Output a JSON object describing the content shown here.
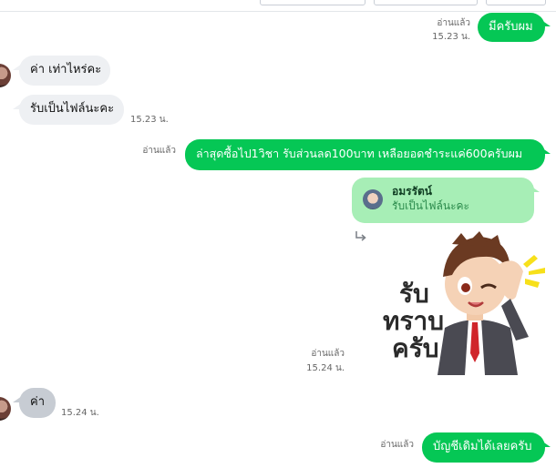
{
  "messages": {
    "m1": {
      "text": "มีครับผม",
      "status": "อ่านแล้ว",
      "time": "15.23 น."
    },
    "m2": {
      "text": "ค่า เท่าไหร่คะ"
    },
    "m3": {
      "text": "รับเป็นไฟล์นะคะ",
      "time": "15.23 น."
    },
    "m4": {
      "text": "ล่าสุดซื้อไป1วิชา รับส่วนลด100บาท เหลือยอดชำระแค่600ครับผม",
      "status": "อ่านแล้ว"
    },
    "m5": {
      "reply_name": "อมรรัตน์",
      "reply_text": "รับเป็นไฟล์นะคะ"
    },
    "sticker": {
      "lines": [
        "รับ",
        "ทราบ",
        "ครับ"
      ],
      "status": "อ่านแล้ว",
      "time": "15.24 น."
    },
    "m6": {
      "text": "ค่า",
      "time": "15.24 น."
    },
    "m7": {
      "text": "บัญชีเดิมได้เลยครับ",
      "status": "อ่านแล้ว"
    }
  },
  "colors": {
    "outgoing": "#05c755",
    "incoming": "#eef0f3",
    "reply_card": "#a7eeb6"
  },
  "icons": {
    "reply_arrow": "reply-arrow-icon"
  }
}
